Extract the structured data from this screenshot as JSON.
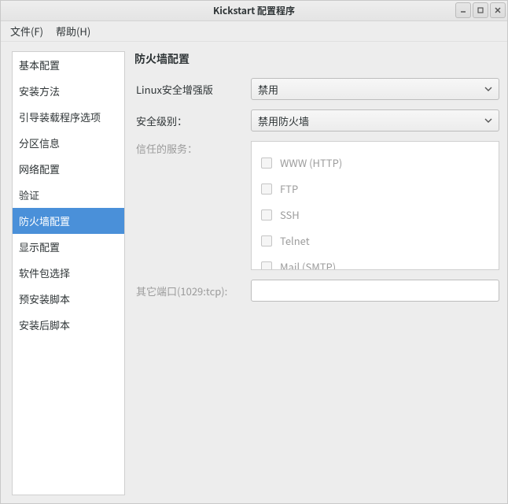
{
  "title": "Kickstart 配置程序",
  "menu": {
    "file": "文件(F)",
    "help": "帮助(H)"
  },
  "sidebar": {
    "items": [
      {
        "label": "基本配置",
        "selected": false
      },
      {
        "label": "安装方法",
        "selected": false
      },
      {
        "label": "引导装载程序选项",
        "selected": false
      },
      {
        "label": "分区信息",
        "selected": false
      },
      {
        "label": "网络配置",
        "selected": false
      },
      {
        "label": "验证",
        "selected": false
      },
      {
        "label": "防火墙配置",
        "selected": true
      },
      {
        "label": "显示配置",
        "selected": false
      },
      {
        "label": "软件包选择",
        "selected": false
      },
      {
        "label": "预安装脚本",
        "selected": false
      },
      {
        "label": "安装后脚本",
        "selected": false
      }
    ]
  },
  "panel": {
    "title": "防火墙配置",
    "selinux_label": "Linux安全增强版",
    "selinux_value": "禁用",
    "security_level_label": "安全级别：",
    "security_level_value": "禁用防火墙",
    "trusted_services_label": "信任的服务：",
    "services": [
      {
        "label": "WWW (HTTP)"
      },
      {
        "label": "FTP"
      },
      {
        "label": "SSH"
      },
      {
        "label": "Telnet"
      },
      {
        "label": "Mail (SMTP)"
      }
    ],
    "other_ports_label": "其它端口(1029:tcp):",
    "other_ports_value": ""
  }
}
